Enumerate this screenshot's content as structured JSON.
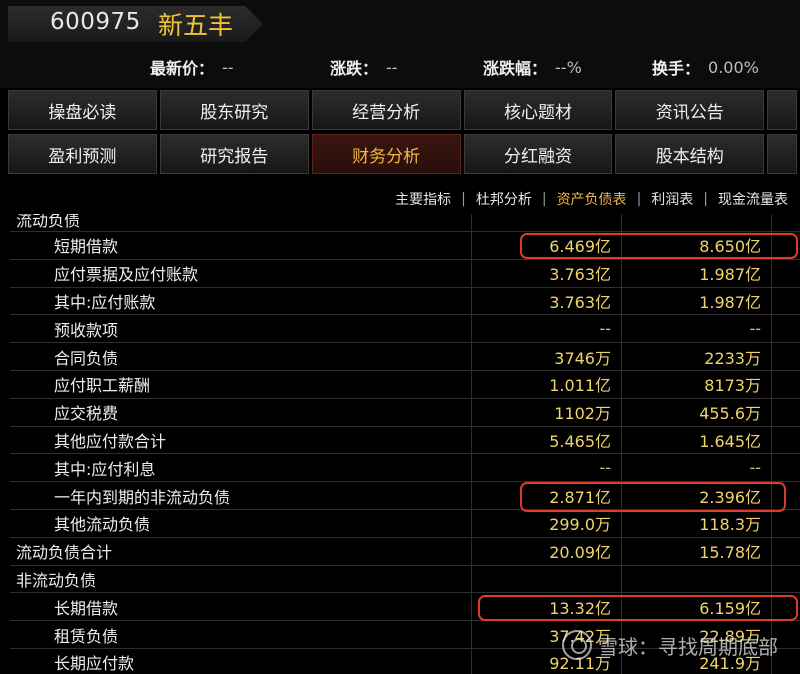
{
  "stock": {
    "code": "600975",
    "name": "新五丰"
  },
  "quote": {
    "price_label": "最新价：",
    "price": "--",
    "change_label": "涨跌：",
    "change": "--",
    "pct_label": "涨跌幅：",
    "pct": "--%",
    "turnover_label": "换手：",
    "turnover": "0.00%"
  },
  "nav_row1": [
    "操盘必读",
    "股东研究",
    "经营分析",
    "核心题材",
    "资讯公告"
  ],
  "nav_row2": [
    "盈利预测",
    "研究报告",
    "财务分析",
    "分红融资",
    "股本结构"
  ],
  "active_nav": "财务分析",
  "subtabs": [
    "主要指标",
    "杜邦分析",
    "资产负债表",
    "利润表",
    "现金流量表"
  ],
  "active_subtab": "资产负债表",
  "table": {
    "rows": [
      {
        "label": "流动负债",
        "v1": "",
        "v2": ""
      },
      {
        "label": "短期借款",
        "v1": "6.469亿",
        "v2": "8.650亿"
      },
      {
        "label": "应付票据及应付账款",
        "v1": "3.763亿",
        "v2": "1.987亿"
      },
      {
        "label": "其中:应付账款",
        "v1": "3.763亿",
        "v2": "1.987亿"
      },
      {
        "label": "预收款项",
        "v1": "--",
        "v2": "--"
      },
      {
        "label": "合同负债",
        "v1": "3746万",
        "v2": "2233万"
      },
      {
        "label": "应付职工薪酬",
        "v1": "1.011亿",
        "v2": "8173万"
      },
      {
        "label": "应交税费",
        "v1": "1102万",
        "v2": "455.6万"
      },
      {
        "label": "其他应付款合计",
        "v1": "5.465亿",
        "v2": "1.645亿"
      },
      {
        "label": "其中:应付利息",
        "v1": "--",
        "v2": "--"
      },
      {
        "label": "一年内到期的非流动负债",
        "v1": "2.871亿",
        "v2": "2.396亿"
      },
      {
        "label": "其他流动负债",
        "v1": "299.0万",
        "v2": "118.3万"
      },
      {
        "label": "流动负债合计",
        "v1": "20.09亿",
        "v2": "15.78亿"
      },
      {
        "label": "非流动负债",
        "v1": "",
        "v2": ""
      },
      {
        "label": "长期借款",
        "v1": "13.32亿",
        "v2": "6.159亿"
      },
      {
        "label": "租赁负债",
        "v1": "37.42万",
        "v2": "22.89万"
      },
      {
        "label": "长期应付款",
        "v1": "92.11万",
        "v2": "241.9万"
      }
    ]
  },
  "watermark": "雪球：寻找周期底部",
  "colors": {
    "accent": "#f2b640",
    "value": "#f0d36a",
    "highlight": "#e03a2a"
  }
}
